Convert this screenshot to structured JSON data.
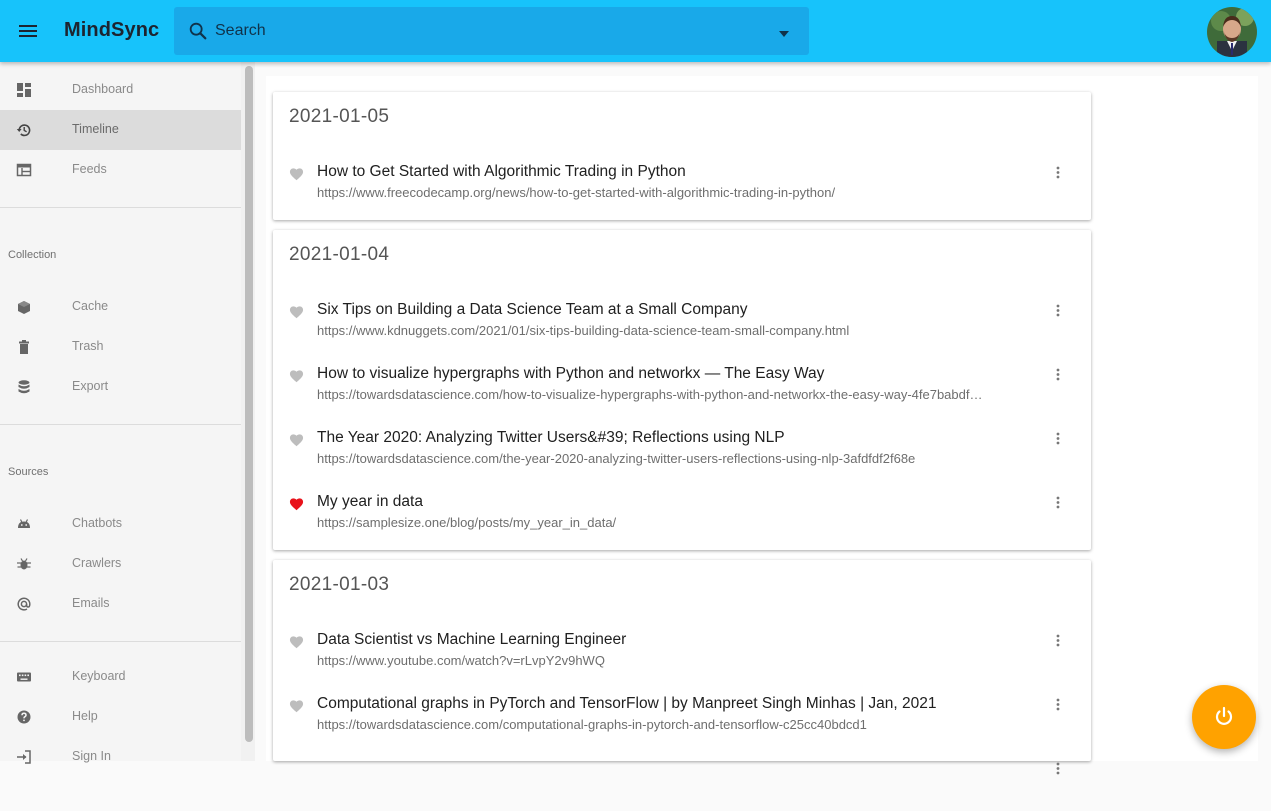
{
  "app": {
    "title": "MindSync"
  },
  "search": {
    "placeholder": "Search"
  },
  "sidebar": {
    "main": [
      {
        "label": "Dashboard",
        "icon": "dashboard-icon",
        "active": false
      },
      {
        "label": "Timeline",
        "icon": "history-icon",
        "active": true
      },
      {
        "label": "Feeds",
        "icon": "feeds-icon",
        "active": false
      }
    ],
    "collection_label": "Collection",
    "collection": [
      {
        "label": "Cache",
        "icon": "cache-icon"
      },
      {
        "label": "Trash",
        "icon": "trash-icon"
      },
      {
        "label": "Export",
        "icon": "database-icon"
      }
    ],
    "sources_label": "Sources",
    "sources": [
      {
        "label": "Chatbots",
        "icon": "android-icon"
      },
      {
        "label": "Crawlers",
        "icon": "bug-icon"
      },
      {
        "label": "Emails",
        "icon": "at-icon"
      }
    ],
    "bottom": [
      {
        "label": "Keyboard",
        "icon": "keyboard-icon"
      },
      {
        "label": "Help",
        "icon": "help-icon"
      },
      {
        "label": "Sign In",
        "icon": "sign-in-icon"
      }
    ]
  },
  "timeline": [
    {
      "date": "2021-01-05",
      "entries": [
        {
          "title": "How to Get Started with Algorithmic Trading in Python",
          "url": "https://www.freecodecamp.org/news/how-to-get-started-with-algorithmic-trading-in-python/",
          "liked": false
        }
      ]
    },
    {
      "date": "2021-01-04",
      "entries": [
        {
          "title": "Six Tips on Building a Data Science Team at a Small Company",
          "url": "https://www.kdnuggets.com/2021/01/six-tips-building-data-science-team-small-company.html",
          "liked": false
        },
        {
          "title": "How to visualize hypergraphs with Python and networkx — The Easy Way",
          "url": "https://towardsdatascience.com/how-to-visualize-hypergraphs-with-python-and-networkx-the-easy-way-4fe7babdf…",
          "liked": false
        },
        {
          "title": "The Year 2020: Analyzing Twitter Users&#39; Reflections using NLP",
          "url": "https://towardsdatascience.com/the-year-2020-analyzing-twitter-users-reflections-using-nlp-3afdfdf2f68e",
          "liked": false
        },
        {
          "title": "My year in data",
          "url": "https://samplesize.one/blog/posts/my_year_in_data/",
          "liked": true
        }
      ]
    },
    {
      "date": "2021-01-03",
      "entries": [
        {
          "title": "Data Scientist vs Machine Learning Engineer",
          "url": "https://www.youtube.com/watch?v=rLvpY2v9hWQ",
          "liked": false
        },
        {
          "title": "Computational graphs in PyTorch and TensorFlow | by Manpreet Singh Minhas | Jan, 2021",
          "url": "https://towardsdatascience.com/computational-graphs-in-pytorch-and-tensorflow-c25cc40bdcd1",
          "liked": false
        }
      ]
    }
  ],
  "colors": {
    "appbar": "#17c3fb",
    "fab": "#ffa200",
    "heart_liked": "#e8121b",
    "heart_default": "#bdbdbd"
  }
}
